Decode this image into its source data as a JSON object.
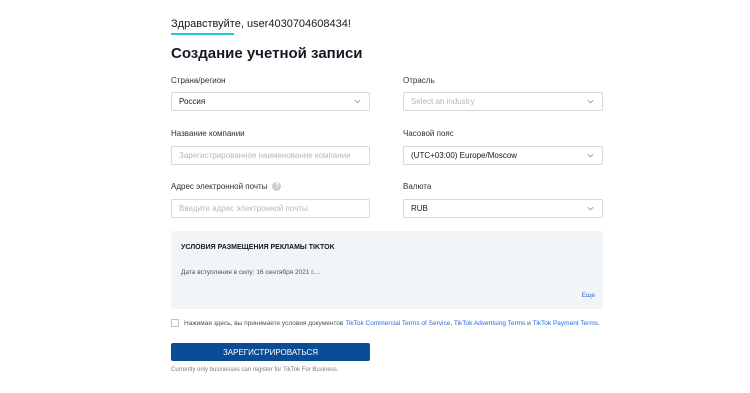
{
  "header": {
    "greeting": "Здравствуйте, user4030704608434!",
    "title": "Создание учетной записи",
    "accent_color": "#25c5d3"
  },
  "form": {
    "country": {
      "label": "Страна/регион",
      "value": "Россия",
      "placeholder": ""
    },
    "industry": {
      "label": "Отрасль",
      "value": "",
      "placeholder": "Select an industry"
    },
    "company": {
      "label": "Название компании",
      "value": "",
      "placeholder": "Зарегистрированное наименование  компании"
    },
    "timezone": {
      "label": "Часовой пояс",
      "value": "(UTC+03:00) Europe/Moscow",
      "placeholder": ""
    },
    "email": {
      "label": "Адрес электронной почты",
      "value": "",
      "placeholder": "Введите адрес электронной почты.",
      "help_icon": "question-circle-icon"
    },
    "currency": {
      "label": "Валюта",
      "value": "RUB",
      "placeholder": ""
    }
  },
  "terms": {
    "title": "УСЛОВИЯ РАЗМЕЩЕНИЯ РЕКЛАМЫ TIKTOK",
    "effective_date": "Дата вступления в силу: 16 сентября 2021 г....",
    "more_link": "Еще"
  },
  "agreement": {
    "text": "Нажимая здесь, вы принимаете условия документов",
    "link1": "TikTok Commercial Terms of Service",
    "sep1": ",",
    "link2": "TikTok Advertising Terms",
    "sep2": "и",
    "link3": "TikTok Payment Terms",
    "end": ".",
    "checked": false
  },
  "actions": {
    "register_label": "ЗАРЕГИСТРИРОВАТЬСЯ",
    "button_color": "#0a4d96"
  },
  "footnote": "Currently only businesses can register for TikTok For Business."
}
